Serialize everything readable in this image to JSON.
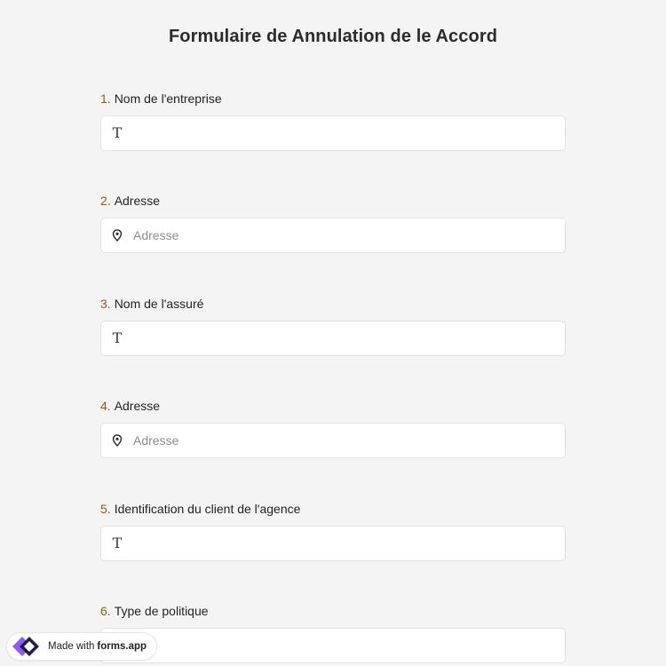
{
  "form": {
    "title": "Formulaire de Annulation de le Accord"
  },
  "questions": [
    {
      "number": "1.",
      "label": "Nom de l'entreprise",
      "icon": "text-icon",
      "placeholder": "",
      "value": ""
    },
    {
      "number": "2.",
      "label": "Adresse",
      "icon": "location-pin-icon",
      "placeholder": "Adresse",
      "value": ""
    },
    {
      "number": "3.",
      "label": "Nom de l'assuré",
      "icon": "text-icon",
      "placeholder": "",
      "value": ""
    },
    {
      "number": "4.",
      "label": "Adresse",
      "icon": "location-pin-icon",
      "placeholder": "Adresse",
      "value": ""
    },
    {
      "number": "5.",
      "label": "Identification du client de l'agence",
      "icon": "text-icon",
      "placeholder": "",
      "value": ""
    },
    {
      "number": "6.",
      "label": "Type de politique",
      "icon": "",
      "placeholder": "",
      "value": ""
    }
  ],
  "badge": {
    "made_with": "Made with",
    "brand": "forms.app",
    "logo_icon": "forms-app-logo-icon"
  },
  "colors": {
    "background": "#f4f4f4",
    "number_accent": "#8a5a22",
    "logo_purple": "#8b5cf6",
    "logo_dark": "#1f1f3a"
  }
}
